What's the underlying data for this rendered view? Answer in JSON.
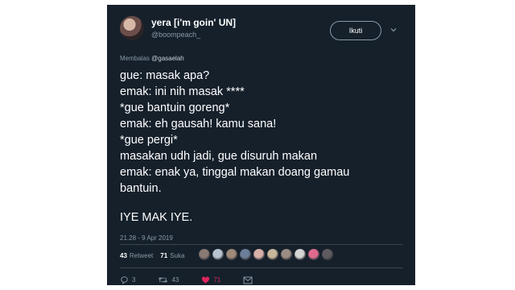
{
  "user": {
    "display_name": "yera [i'm goin' UN]",
    "handle": "@boompeach_"
  },
  "follow_button_label": "Ikuti",
  "reply_to": {
    "prefix": "Membalas",
    "mention": "@gasaelah"
  },
  "tweet_lines": [
    "gue: masak apa?",
    "emak: ini nih masak ****",
    "*gue bantuin goreng*",
    "emak: eh gausah! kamu sana!",
    "*gue pergi*",
    "masakan udh jadi, gue disuruh makan",
    "emak: enak ya, tinggal makan doang gamau",
    "bantuin."
  ],
  "tweet_closing": "IYE MAK IYE.",
  "timestamp": "21.28 - 9 Apr 2019",
  "stats": {
    "retweet_count": "43",
    "retweet_label": "Retweet",
    "like_count": "71",
    "like_label": "Suka"
  },
  "liker_avatar_colors": [
    "#8a7a74",
    "#b7c3cf",
    "#a08a7a",
    "#6c7e9a",
    "#d8b0a8",
    "#c7b79a",
    "#9c8d84",
    "#d5d5d5",
    "#e06a8e",
    "#5e5a60"
  ],
  "actions": {
    "reply_count": "3",
    "retweet_count": "43",
    "like_count": "71"
  },
  "colors": {
    "background": "#15202b",
    "secondary_text": "#8899a6",
    "like_accent": "#e0245e"
  },
  "icons": [
    "avatar",
    "chevron-down-icon",
    "reply-icon",
    "retweet-icon",
    "heart-icon",
    "message-icon"
  ]
}
